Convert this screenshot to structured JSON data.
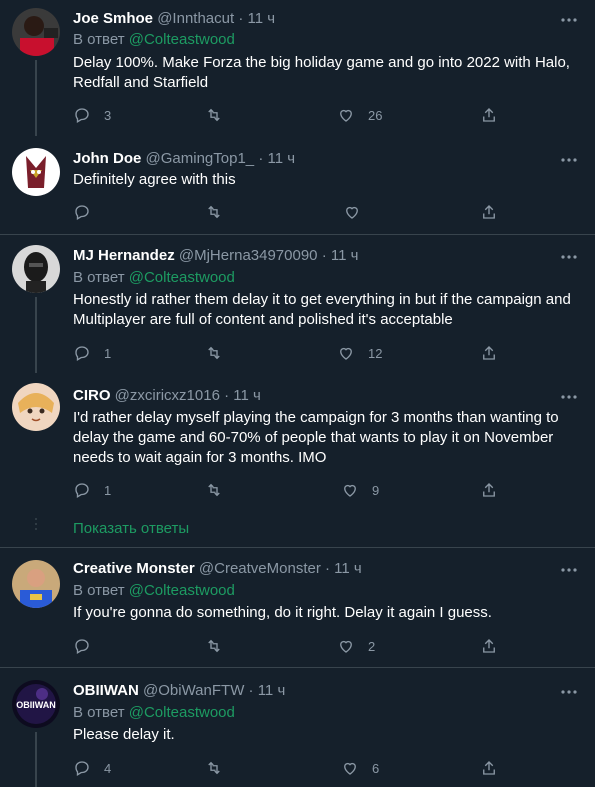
{
  "reply_prefix": "В ответ",
  "show_replies_label": "Показать ответы",
  "tweets": [
    {
      "name": "Joe Smhoe",
      "handle": "@Innthacut",
      "time": "11 ч",
      "reply_to": "@Colteastwood",
      "text": "Delay 100%. Make Forza the big holiday game and go into 2022 with Halo, Redfall and Starfield",
      "replies": "3",
      "retweets": "",
      "likes": "26"
    },
    {
      "name": "John Doe",
      "handle": "@GamingTop1_",
      "time": "11 ч",
      "reply_to": "",
      "text": "Definitely agree with this",
      "replies": "",
      "retweets": "",
      "likes": ""
    },
    {
      "name": "MJ Hernandez",
      "handle": "@MjHerna34970090",
      "time": "11 ч",
      "reply_to": "@Colteastwood",
      "text": "Honestly id rather them delay it to get everything in but if the campaign and Multiplayer are full of content and polished it's acceptable",
      "replies": "1",
      "retweets": "",
      "likes": "12"
    },
    {
      "name": "CIRO",
      "handle": "@zxciricxz1016",
      "time": "11 ч",
      "reply_to": "",
      "text": "I'd rather delay myself playing the campaign for 3 months than wanting to delay the game and 60-70% of people that wants to play it on November needs to wait again for 3 months. IMO",
      "replies": "1",
      "retweets": "",
      "likes": "9"
    },
    {
      "name": "Creative Monster",
      "handle": "@CreatveMonster",
      "time": "11 ч",
      "reply_to": "@Colteastwood",
      "text": "If you're gonna do something, do it right. Delay it again I guess.",
      "replies": "",
      "retweets": "",
      "likes": "2"
    },
    {
      "name": "OBIIWAN",
      "handle": "@ObiWanFTW",
      "time": "11 ч",
      "reply_to": "@Colteastwood",
      "text": "Please delay it.",
      "replies": "4",
      "retweets": "",
      "likes": "6"
    }
  ],
  "avatar_logo_text": "OBIIWAN",
  "colors": {
    "background": "#15202b",
    "accent": "#1d9b62",
    "muted": "#8b98a5",
    "divider": "#38444d"
  }
}
